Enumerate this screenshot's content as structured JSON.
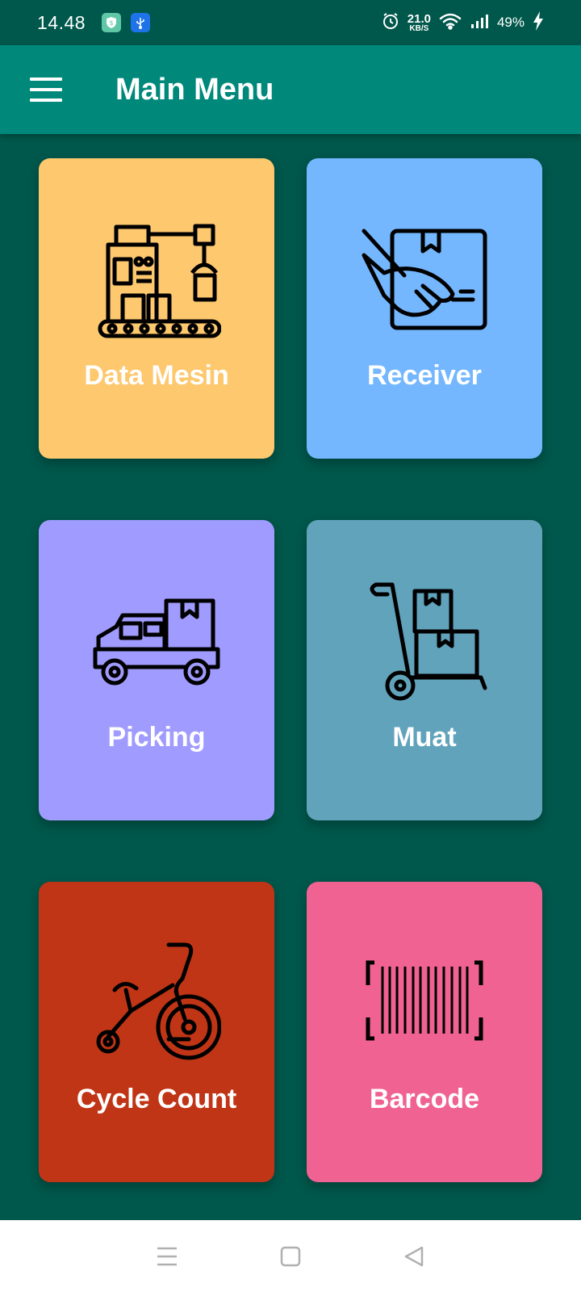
{
  "status_bar": {
    "time": "14.48",
    "net_speed_value": "21.0",
    "net_speed_unit": "KB/S",
    "battery": "49%",
    "icons": [
      "shield-app-icon",
      "usb-icon",
      "alarm-icon",
      "wifi-icon",
      "signal-icon",
      "charging-icon"
    ]
  },
  "app_bar": {
    "title": "Main Menu",
    "menu_icon": "hamburger-menu-icon"
  },
  "menu": [
    {
      "label": "Data Mesin",
      "icon": "factory-machine-icon",
      "color": "#fdc86e"
    },
    {
      "label": "Receiver",
      "icon": "hand-box-icon",
      "color": "#74b7ff"
    },
    {
      "label": "Picking",
      "icon": "pickup-truck-icon",
      "color": "#a09bfe"
    },
    {
      "label": "Muat",
      "icon": "hand-truck-icon",
      "color": "#62a3bc"
    },
    {
      "label": "Cycle Count",
      "icon": "tricycle-icon",
      "color": "#c03515"
    },
    {
      "label": "Barcode",
      "icon": "barcode-scan-icon",
      "color": "#f06292"
    }
  ],
  "nav_bar": {
    "buttons": [
      "recents-icon",
      "home-icon",
      "back-icon"
    ]
  },
  "colors": {
    "background": "#00574b",
    "app_bar": "#00897b",
    "text": "#ffffff"
  }
}
